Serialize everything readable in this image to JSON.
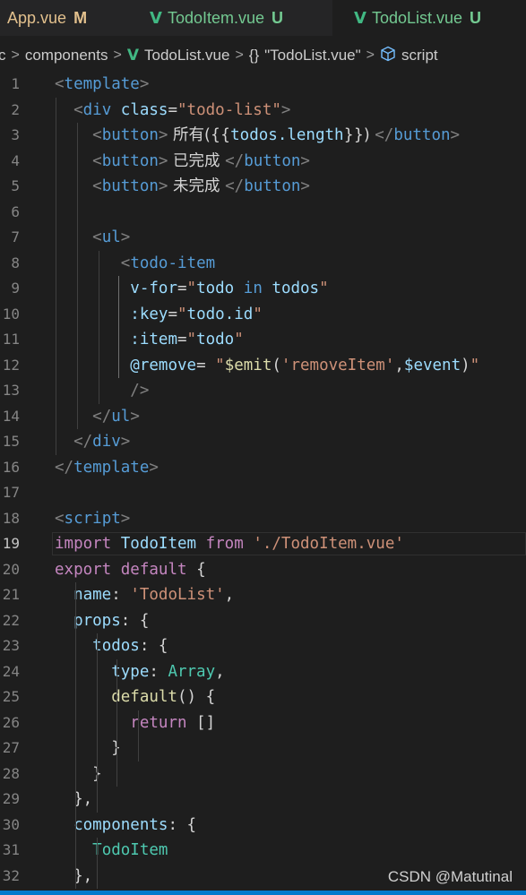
{
  "tabs": [
    {
      "label": "App.vue",
      "status": "M",
      "label_color": "#e2c08d",
      "status_color": "#e2c08d",
      "icon": "",
      "active": false
    },
    {
      "label": "TodoItem.vue",
      "status": "U",
      "label_color": "#73c991",
      "status_color": "#73c991",
      "icon": "vue-icon",
      "active": false
    },
    {
      "label": "TodoList.vue",
      "status": "U",
      "label_color": "#73c991",
      "status_color": "#73c991",
      "icon": "vue-icon",
      "active": true
    }
  ],
  "breadcrumb": {
    "root": "c",
    "folder": "components",
    "file": "TodoList.vue",
    "scope": "\"TodoList.vue\"",
    "scope_icon_text": "{}",
    "section": "script"
  },
  "editor": {
    "active_line": 19,
    "lines": [
      {
        "n": "1",
        "t": [
          [
            "t-punct",
            "<"
          ],
          [
            "t-tag",
            "template"
          ],
          [
            "t-punct",
            ">"
          ]
        ]
      },
      {
        "n": "2",
        "t": [
          [
            "t-plain",
            "  "
          ],
          [
            "t-punct",
            "<"
          ],
          [
            "t-tag",
            "div"
          ],
          [
            "t-plain",
            " "
          ],
          [
            "t-attr",
            "class"
          ],
          [
            "t-plain",
            "="
          ],
          [
            "t-str",
            "\"todo-list\""
          ],
          [
            "t-punct",
            ">"
          ]
        ]
      },
      {
        "n": "3",
        "t": [
          [
            "t-plain",
            "    "
          ],
          [
            "t-punct",
            "<"
          ],
          [
            "t-tag",
            "button"
          ],
          [
            "t-punct",
            ">"
          ],
          [
            "t-text",
            " 所有({{"
          ],
          [
            "t-var",
            "todos.length"
          ],
          [
            "t-text",
            "}}) "
          ],
          [
            "t-punct",
            "</"
          ],
          [
            "t-tag",
            "button"
          ],
          [
            "t-punct",
            ">"
          ]
        ]
      },
      {
        "n": "4",
        "t": [
          [
            "t-plain",
            "    "
          ],
          [
            "t-punct",
            "<"
          ],
          [
            "t-tag",
            "button"
          ],
          [
            "t-punct",
            ">"
          ],
          [
            "t-text",
            " 已完成 "
          ],
          [
            "t-punct",
            "</"
          ],
          [
            "t-tag",
            "button"
          ],
          [
            "t-punct",
            ">"
          ]
        ]
      },
      {
        "n": "5",
        "t": [
          [
            "t-plain",
            "    "
          ],
          [
            "t-punct",
            "<"
          ],
          [
            "t-tag",
            "button"
          ],
          [
            "t-punct",
            ">"
          ],
          [
            "t-text",
            " 未完成 "
          ],
          [
            "t-punct",
            "</"
          ],
          [
            "t-tag",
            "button"
          ],
          [
            "t-punct",
            ">"
          ]
        ]
      },
      {
        "n": "6",
        "t": []
      },
      {
        "n": "7",
        "t": [
          [
            "t-plain",
            "    "
          ],
          [
            "t-punct",
            "<"
          ],
          [
            "t-tag",
            "ul"
          ],
          [
            "t-punct",
            ">"
          ]
        ]
      },
      {
        "n": "8",
        "t": [
          [
            "t-plain",
            "       "
          ],
          [
            "t-punct",
            "<"
          ],
          [
            "t-tag",
            "todo-item"
          ]
        ]
      },
      {
        "n": "9",
        "t": [
          [
            "t-plain",
            "        "
          ],
          [
            "t-attr",
            "v-for"
          ],
          [
            "t-plain",
            "="
          ],
          [
            "t-str",
            "\""
          ],
          [
            "t-var",
            "todo"
          ],
          [
            "t-plain",
            " "
          ],
          [
            "t-kw2",
            "in"
          ],
          [
            "t-plain",
            " "
          ],
          [
            "t-var",
            "todos"
          ],
          [
            "t-str",
            "\""
          ]
        ]
      },
      {
        "n": "10",
        "t": [
          [
            "t-plain",
            "        "
          ],
          [
            "t-attr",
            ":key"
          ],
          [
            "t-plain",
            "="
          ],
          [
            "t-str",
            "\""
          ],
          [
            "t-var",
            "todo.id"
          ],
          [
            "t-str",
            "\""
          ]
        ]
      },
      {
        "n": "11",
        "t": [
          [
            "t-plain",
            "        "
          ],
          [
            "t-attr",
            ":item"
          ],
          [
            "t-plain",
            "="
          ],
          [
            "t-str",
            "\""
          ],
          [
            "t-var",
            "todo"
          ],
          [
            "t-str",
            "\""
          ]
        ]
      },
      {
        "n": "12",
        "t": [
          [
            "t-plain",
            "        "
          ],
          [
            "t-attr",
            "@remove"
          ],
          [
            "t-plain",
            "= "
          ],
          [
            "t-str",
            "\""
          ],
          [
            "t-fn",
            "$emit"
          ],
          [
            "t-plain",
            "("
          ],
          [
            "t-str",
            "'removeItem'"
          ],
          [
            "t-plain",
            ","
          ],
          [
            "t-var",
            "$event"
          ],
          [
            "t-plain",
            ")"
          ],
          [
            "t-str",
            "\""
          ]
        ]
      },
      {
        "n": "13",
        "t": [
          [
            "t-plain",
            "        "
          ],
          [
            "t-punct",
            "/>"
          ]
        ]
      },
      {
        "n": "14",
        "t": [
          [
            "t-plain",
            "    "
          ],
          [
            "t-punct",
            "</"
          ],
          [
            "t-tag",
            "ul"
          ],
          [
            "t-punct",
            ">"
          ]
        ]
      },
      {
        "n": "15",
        "t": [
          [
            "t-plain",
            "  "
          ],
          [
            "t-punct",
            "</"
          ],
          [
            "t-tag",
            "div"
          ],
          [
            "t-punct",
            ">"
          ]
        ]
      },
      {
        "n": "16",
        "t": [
          [
            "t-punct",
            "</"
          ],
          [
            "t-tag",
            "template"
          ],
          [
            "t-punct",
            ">"
          ]
        ]
      },
      {
        "n": "17",
        "t": []
      },
      {
        "n": "18",
        "t": [
          [
            "t-punct",
            "<"
          ],
          [
            "t-tag",
            "script"
          ],
          [
            "t-punct",
            ">"
          ]
        ]
      },
      {
        "n": "19",
        "t": [
          [
            "t-kw",
            "import"
          ],
          [
            "t-plain",
            " "
          ],
          [
            "t-var",
            "TodoItem"
          ],
          [
            "t-plain",
            " "
          ],
          [
            "t-kw",
            "from"
          ],
          [
            "t-plain",
            " "
          ],
          [
            "t-str",
            "'./TodoItem.vue'"
          ]
        ]
      },
      {
        "n": "20",
        "t": [
          [
            "t-kw",
            "export"
          ],
          [
            "t-plain",
            " "
          ],
          [
            "t-kw",
            "default"
          ],
          [
            "t-plain",
            " {"
          ]
        ]
      },
      {
        "n": "21",
        "t": [
          [
            "t-plain",
            "  "
          ],
          [
            "t-var",
            "name"
          ],
          [
            "t-plain",
            ": "
          ],
          [
            "t-str",
            "'TodoList'"
          ],
          [
            "t-plain",
            ","
          ]
        ]
      },
      {
        "n": "22",
        "t": [
          [
            "t-plain",
            "  "
          ],
          [
            "t-var",
            "props"
          ],
          [
            "t-plain",
            ": {"
          ]
        ]
      },
      {
        "n": "23",
        "t": [
          [
            "t-plain",
            "    "
          ],
          [
            "t-var",
            "todos"
          ],
          [
            "t-plain",
            ": {"
          ]
        ]
      },
      {
        "n": "24",
        "t": [
          [
            "t-plain",
            "      "
          ],
          [
            "t-var",
            "type"
          ],
          [
            "t-plain",
            ": "
          ],
          [
            "t-comp",
            "Array"
          ],
          [
            "t-plain",
            ","
          ]
        ]
      },
      {
        "n": "25",
        "t": [
          [
            "t-plain",
            "      "
          ],
          [
            "t-fn",
            "default"
          ],
          [
            "t-plain",
            "() {"
          ]
        ]
      },
      {
        "n": "26",
        "t": [
          [
            "t-plain",
            "        "
          ],
          [
            "t-kw",
            "return"
          ],
          [
            "t-plain",
            " []"
          ]
        ]
      },
      {
        "n": "27",
        "t": [
          [
            "t-plain",
            "      }"
          ]
        ]
      },
      {
        "n": "28",
        "t": [
          [
            "t-plain",
            "    }"
          ]
        ]
      },
      {
        "n": "29",
        "t": [
          [
            "t-plain",
            "  },"
          ]
        ]
      },
      {
        "n": "30",
        "t": [
          [
            "t-plain",
            "  "
          ],
          [
            "t-var",
            "components"
          ],
          [
            "t-plain",
            ": {"
          ]
        ]
      },
      {
        "n": "31",
        "t": [
          [
            "t-plain",
            "    "
          ],
          [
            "t-comp",
            "TodoItem"
          ]
        ]
      },
      {
        "n": "32",
        "t": [
          [
            "t-plain",
            "  },"
          ]
        ]
      }
    ]
  },
  "watermark": "CSDN @Matutinal"
}
